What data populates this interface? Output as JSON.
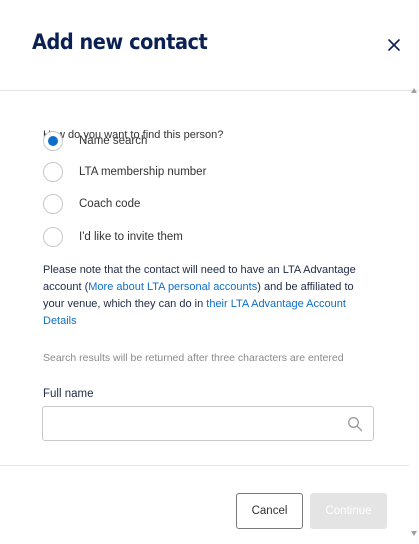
{
  "dialog": {
    "title": "Add new contact",
    "close_icon": "close-icon"
  },
  "form": {
    "question": "How do you want to find this person?",
    "options": [
      {
        "label": "Name search",
        "selected": true
      },
      {
        "label": "LTA membership number",
        "selected": false
      },
      {
        "label": "Coach code",
        "selected": false
      },
      {
        "label": "I'd like to invite them",
        "selected": false
      }
    ],
    "note": {
      "part1": "Please note that the contact will need to have an LTA Advantage account (",
      "link1": "More about LTA personal accounts",
      "part2": ") and be affiliated to your venue, which they can do in ",
      "link2": "their LTA Advantage Account Details"
    },
    "hint": "Search results will be returned after three characters are entered",
    "full_name_label": "Full name",
    "full_name_value": "",
    "full_name_placeholder": "",
    "search_icon": "search-icon"
  },
  "footer": {
    "cancel_label": "Cancel",
    "continue_label": "Continue"
  },
  "colors": {
    "title": "#0b2154",
    "accent": "#0e6fc8",
    "disabled_button": "#e4e4e4"
  }
}
